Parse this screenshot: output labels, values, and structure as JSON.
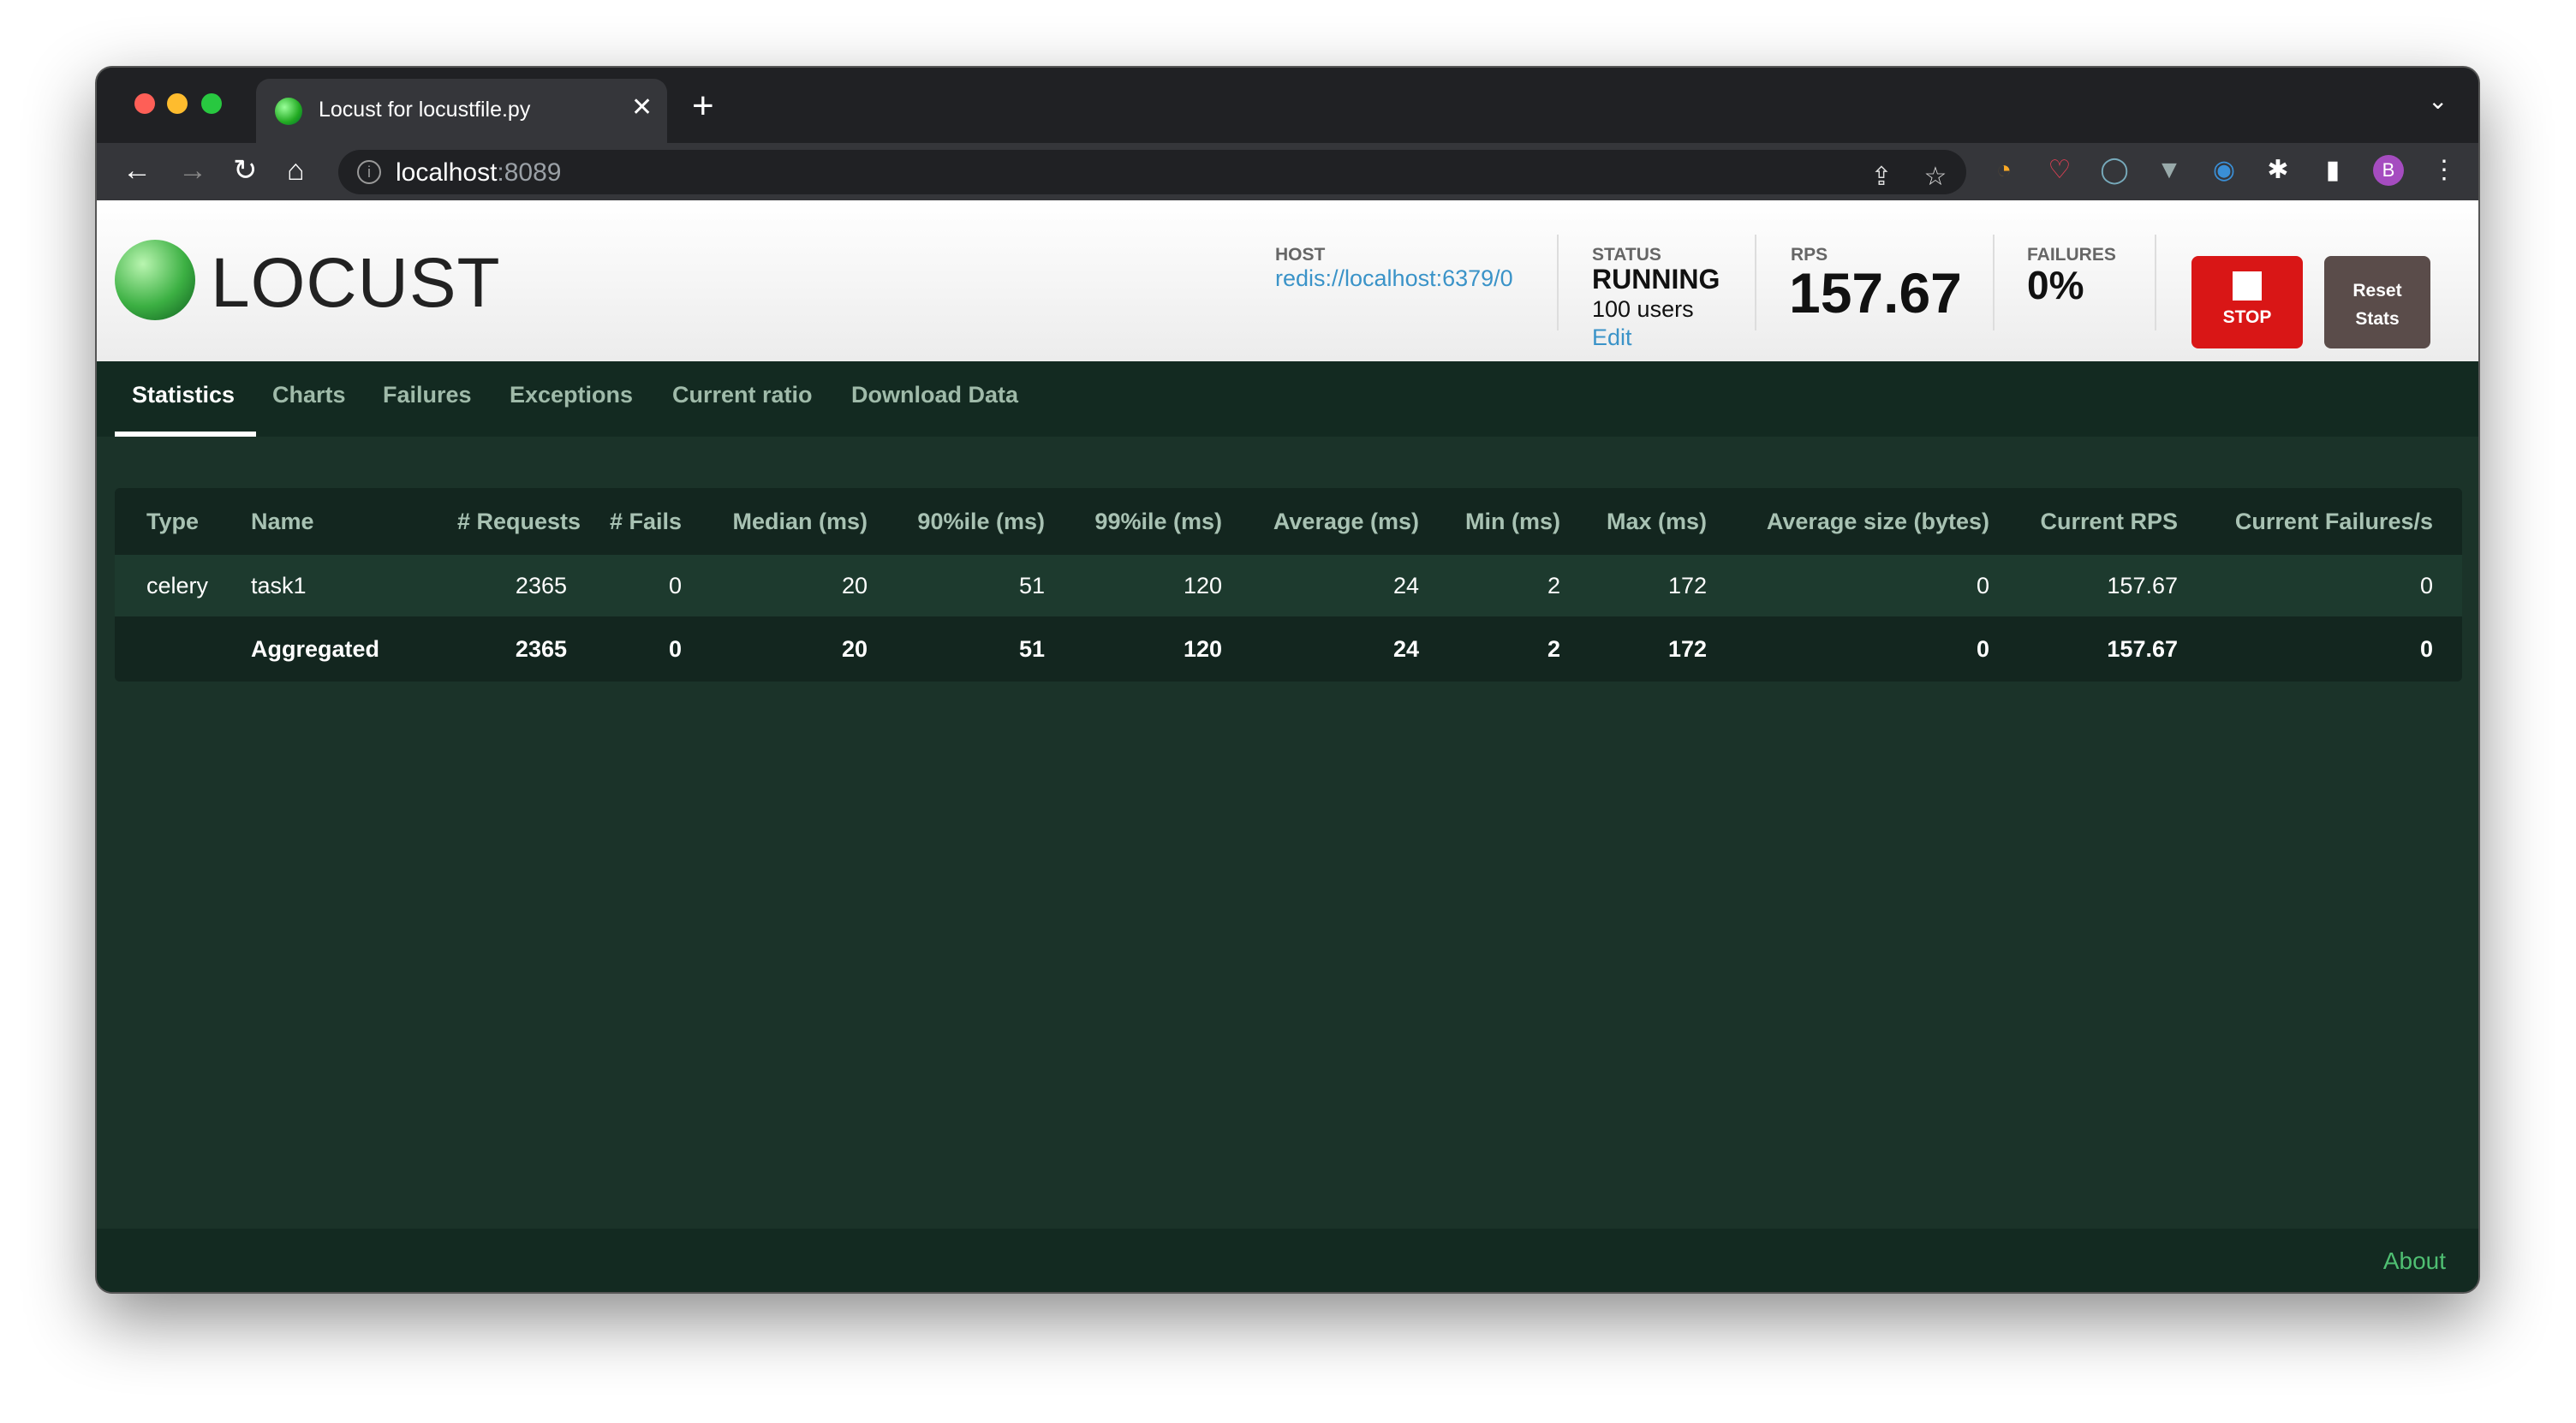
{
  "browser": {
    "tab_title": "Locust for locustfile.py",
    "url_host": "localhost",
    "url_port": ":8089"
  },
  "app": {
    "logo_text": "LOCUST"
  },
  "header": {
    "host_label": "HOST",
    "host_value": "redis://localhost:6379/0",
    "status_label": "STATUS",
    "status_value": "RUNNING",
    "users": "100 users",
    "edit": "Edit",
    "rps_label": "RPS",
    "rps_value": "157.67",
    "failures_label": "FAILURES",
    "failures_value": "0%",
    "stop_label": "STOP",
    "reset_label_1": "Reset",
    "reset_label_2": "Stats",
    "stop_color": "#d91616",
    "reset_color": "#5a4c4a"
  },
  "nav": {
    "items": [
      "Statistics",
      "Charts",
      "Failures",
      "Exceptions",
      "Current ratio",
      "Download Data"
    ]
  },
  "table": {
    "headers": [
      "Type",
      "Name",
      "# Requests",
      "# Fails",
      "Median (ms)",
      "90%ile (ms)",
      "99%ile (ms)",
      "Average (ms)",
      "Min (ms)",
      "Max (ms)",
      "Average size (bytes)",
      "Current RPS",
      "Current Failures/s"
    ],
    "rows": [
      [
        "celery",
        "task1",
        "2365",
        "0",
        "20",
        "51",
        "120",
        "24",
        "2",
        "172",
        "0",
        "157.67",
        "0"
      ],
      [
        "",
        "Aggregated",
        "2365",
        "0",
        "20",
        "51",
        "120",
        "24",
        "2",
        "172",
        "0",
        "157.67",
        "0"
      ]
    ]
  },
  "footer": {
    "about": "About"
  }
}
